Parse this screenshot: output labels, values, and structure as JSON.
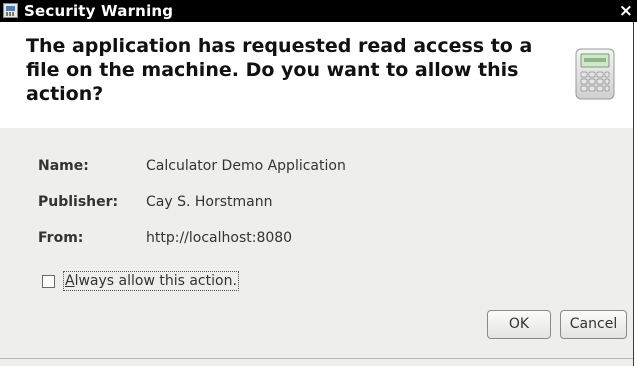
{
  "window": {
    "title": "Security Warning",
    "close_glyph": "×"
  },
  "header": {
    "message": "The application has requested read access to a file on the machine.  Do you want to allow this action?",
    "icon": "calculator-icon"
  },
  "details": [
    {
      "label": "Name:",
      "value": "Calculator Demo Application"
    },
    {
      "label": "Publisher:",
      "value": "Cay S. Horstmann"
    },
    {
      "label": "From:",
      "value": "http://localhost:8080"
    }
  ],
  "checkbox": {
    "mnemonic": "A",
    "label_rest": "lways allow this action.",
    "checked": false
  },
  "buttons": {
    "ok": "OK",
    "cancel": "Cancel"
  }
}
